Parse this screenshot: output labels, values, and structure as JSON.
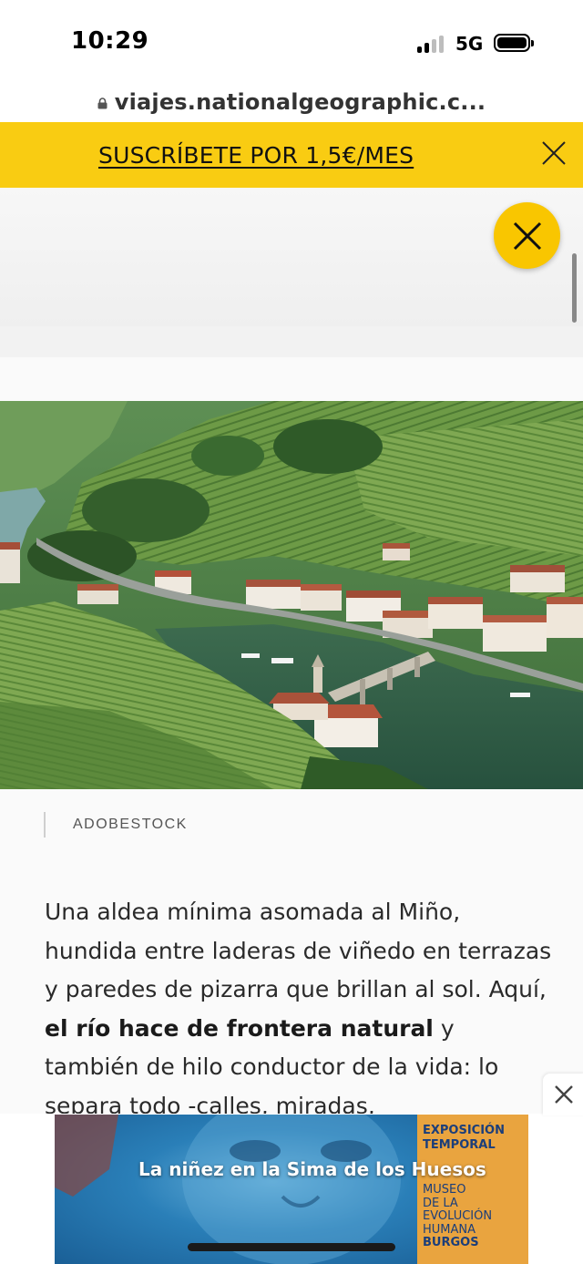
{
  "status_bar": {
    "time": "10:29",
    "network": "5G"
  },
  "browser": {
    "url": "viajes.nationalgeographic.c..."
  },
  "banner": {
    "subscribe_label": "SUSCRÍBETE POR 1,5€/MES"
  },
  "photo": {
    "credit": "ADOBESTOCK"
  },
  "article": {
    "t1": "Una aldea mínima asomada al Miño, hundida entre laderas de viñedo en terrazas y paredes de pizarra que brillan al sol. Aquí, ",
    "b1": "el río hace de frontera natural",
    "t2": " y también de hilo conductor de la vida: lo separa todo -calles, miradas,"
  },
  "bottom_ad": {
    "headline": "La niñez en la Sima de los Huesos",
    "tag_line1": "EXPOSICIÓN",
    "tag_line2": "TEMPORAL",
    "museum_line1": "MUSEO",
    "museum_line2": "DE LA",
    "museum_line3": "EVOLUCIÓN",
    "museum_line4": "HUMANA",
    "city": "BURGOS"
  },
  "colors": {
    "accent_yellow": "#f9cc12",
    "ad_blue": "#2a7fb8",
    "ad_orange": "#e9a43f"
  },
  "icons": [
    "lock-icon",
    "close-icon",
    "close-circle-icon",
    "signal-icon",
    "battery-icon"
  ]
}
